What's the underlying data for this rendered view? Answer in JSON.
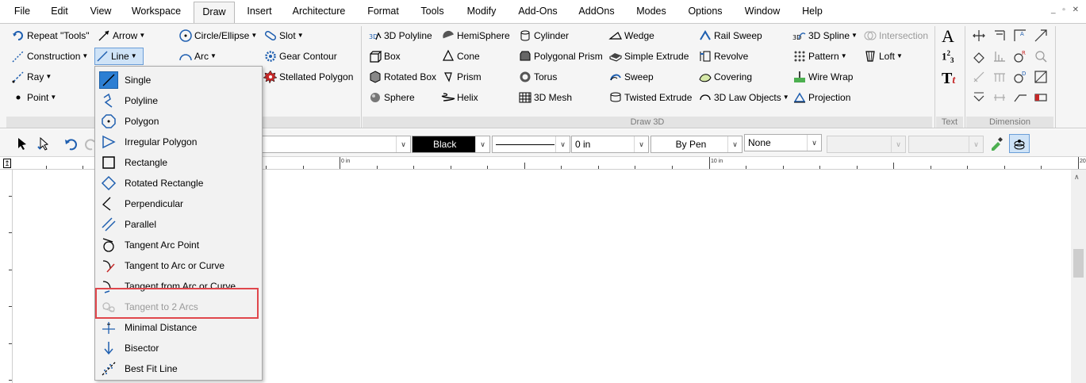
{
  "menubar": {
    "items": [
      "File",
      "Edit",
      "View",
      "Workspace",
      "Draw",
      "Insert",
      "Architecture",
      "Format",
      "Tools",
      "Modify",
      "Add-Ons",
      "AddOns",
      "Modes",
      "Options",
      "Window",
      "Help"
    ],
    "active": "Draw"
  },
  "ribbon": {
    "col1": [
      {
        "label": "Repeat \"Tools\"",
        "icon": "repeat-icon"
      },
      {
        "label": "Construction",
        "icon": "construction-line-icon",
        "dropdown": true
      },
      {
        "label": "Ray",
        "icon": "ray-icon",
        "dropdown": true
      },
      {
        "label": "Point",
        "icon": "point-icon",
        "dropdown": true
      }
    ],
    "col2": [
      {
        "label": "Arrow",
        "icon": "arrow-line-icon",
        "dropdown": true
      },
      {
        "label": "Line",
        "icon": "line-icon",
        "dropdown": true
      }
    ],
    "col3": [
      {
        "label": "Circle/Ellipse",
        "icon": "circle-icon",
        "dropdown": true
      },
      {
        "label": "Arc",
        "icon": "arc-icon",
        "dropdown": true
      }
    ],
    "col4": [
      {
        "label": "Slot",
        "icon": "slot-icon",
        "dropdown": true
      },
      {
        "label": "Gear Contour",
        "icon": "gear-icon"
      },
      {
        "label": "Stellated Polygon",
        "icon": "stellated-polygon-icon"
      }
    ],
    "col5": [
      {
        "label": "3D Polyline",
        "icon": "3d-polyline-icon"
      },
      {
        "label": "Box",
        "icon": "box-icon"
      },
      {
        "label": "Rotated Box",
        "icon": "rotated-box-icon"
      },
      {
        "label": "Sphere",
        "icon": "sphere-icon"
      }
    ],
    "col6": [
      {
        "label": "HemiSphere",
        "icon": "hemisphere-icon"
      },
      {
        "label": "Cone",
        "icon": "cone-icon"
      },
      {
        "label": "Prism",
        "icon": "prism-icon"
      },
      {
        "label": "Helix",
        "icon": "helix-icon"
      }
    ],
    "col7": [
      {
        "label": "Cylinder",
        "icon": "cylinder-icon"
      },
      {
        "label": "Polygonal Prism",
        "icon": "polygonal-prism-icon"
      },
      {
        "label": "Torus",
        "icon": "torus-icon"
      },
      {
        "label": "3D Mesh",
        "icon": "mesh-icon"
      }
    ],
    "col8": [
      {
        "label": "Wedge",
        "icon": "wedge-icon"
      },
      {
        "label": "Simple Extrude",
        "icon": "extrude-icon"
      },
      {
        "label": "Sweep",
        "icon": "sweep-icon"
      },
      {
        "label": "Twisted Extrude",
        "icon": "twisted-extrude-icon"
      }
    ],
    "col9": [
      {
        "label": "Rail Sweep",
        "icon": "rail-sweep-icon"
      },
      {
        "label": "Revolve",
        "icon": "revolve-icon"
      },
      {
        "label": "Covering",
        "icon": "covering-icon"
      },
      {
        "label": "3D Law Objects",
        "icon": "law-objects-icon",
        "dropdown": true
      }
    ],
    "col10": [
      {
        "label": "3D Spline",
        "icon": "3d-spline-icon",
        "dropdown": true
      },
      {
        "label": "Pattern",
        "icon": "pattern-icon",
        "dropdown": true
      },
      {
        "label": "Wire Wrap",
        "icon": "wire-wrap-icon"
      },
      {
        "label": "Projection",
        "icon": "projection-icon"
      }
    ],
    "col11": [
      {
        "label": "Intersection",
        "icon": "intersection-icon",
        "disabled": true
      },
      {
        "label": "Loft",
        "icon": "loft-icon",
        "dropdown": true
      }
    ],
    "groups": {
      "draw3d": "Draw 3D",
      "text": "Text",
      "dimension": "Dimension"
    },
    "text_glyphs": {
      "big_a": "A",
      "numbers": "1",
      "numbers_sup": "2",
      "numbers_sub": "3",
      "tt": "T"
    }
  },
  "toolbar": {
    "color_value": "Black",
    "linewidth_value": "0 in",
    "pen_value": "By Pen",
    "fill_value": "None"
  },
  "ruler": {
    "label_0": "0 in",
    "label_10": "10 in",
    "label_20": "20"
  },
  "line_menu": {
    "items": [
      {
        "label": "Single",
        "icon": "single-line-icon"
      },
      {
        "label": "Polyline",
        "icon": "polyline-icon"
      },
      {
        "label": "Polygon",
        "icon": "polygon-icon"
      },
      {
        "label": "Irregular Polygon",
        "icon": "irregular-polygon-icon"
      },
      {
        "label": "Rectangle",
        "icon": "rectangle-icon"
      },
      {
        "label": "Rotated Rectangle",
        "icon": "rotated-rectangle-icon"
      },
      {
        "label": "Perpendicular",
        "icon": "perpendicular-icon"
      },
      {
        "label": "Parallel",
        "icon": "parallel-icon"
      },
      {
        "label": "Tangent Arc Point",
        "icon": "tangent-arc-point-icon"
      },
      {
        "label": "Tangent to Arc or Curve",
        "icon": "tangent-arc-curve-icon"
      },
      {
        "label": "Tangent from Arc or Curve",
        "icon": "tangent-from-arc-icon"
      },
      {
        "label": "Tangent to 2 Arcs",
        "icon": "tangent-2-arcs-icon",
        "disabled": true
      },
      {
        "label": "Minimal Distance",
        "icon": "minimal-distance-icon"
      },
      {
        "label": "Bisector",
        "icon": "bisector-icon"
      },
      {
        "label": "Best Fit Line",
        "icon": "best-fit-line-icon"
      }
    ]
  },
  "colors": {
    "accent": "#1f5fb0",
    "highlight": "#e0474c",
    "disabled": "#9a9a9a"
  }
}
